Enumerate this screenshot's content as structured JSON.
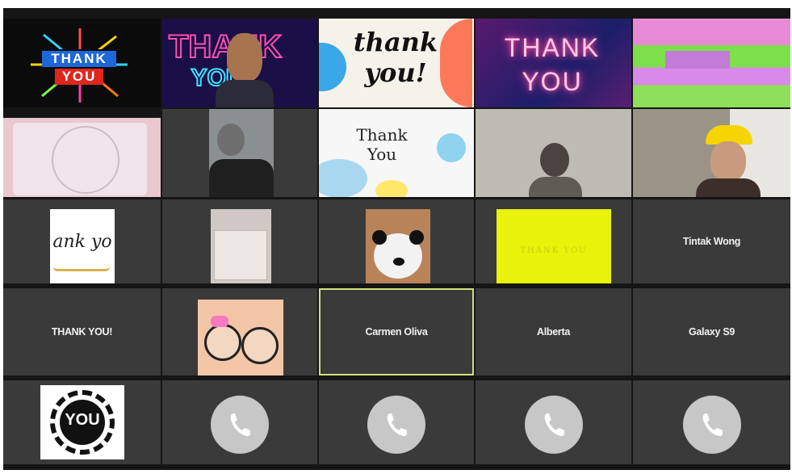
{
  "participants": {
    "tintak": "Tintak Wong",
    "thankyou_name": "THANK YOU!",
    "carmen": "Carmen Oliva",
    "alberta": "Alberta",
    "galaxy": "Galaxy S9"
  },
  "cards": {
    "thank": "THANK",
    "you": "YOU",
    "thank_script": "thank",
    "you_script": "you!",
    "neon_thank": "THANK",
    "neon_you": "YOU",
    "card_thank": "Thank",
    "card_you": "You",
    "handwritten": "ank yo",
    "yellow_card": "THANK YOU",
    "you_sticker": "YOU"
  },
  "icons": {
    "phone": "phone-icon"
  },
  "colors": {
    "grid_bg": "#151515",
    "tile_bg": "#3a3a3a",
    "active_border": "#d3e07a",
    "call_circle": "#c7c7c7"
  }
}
